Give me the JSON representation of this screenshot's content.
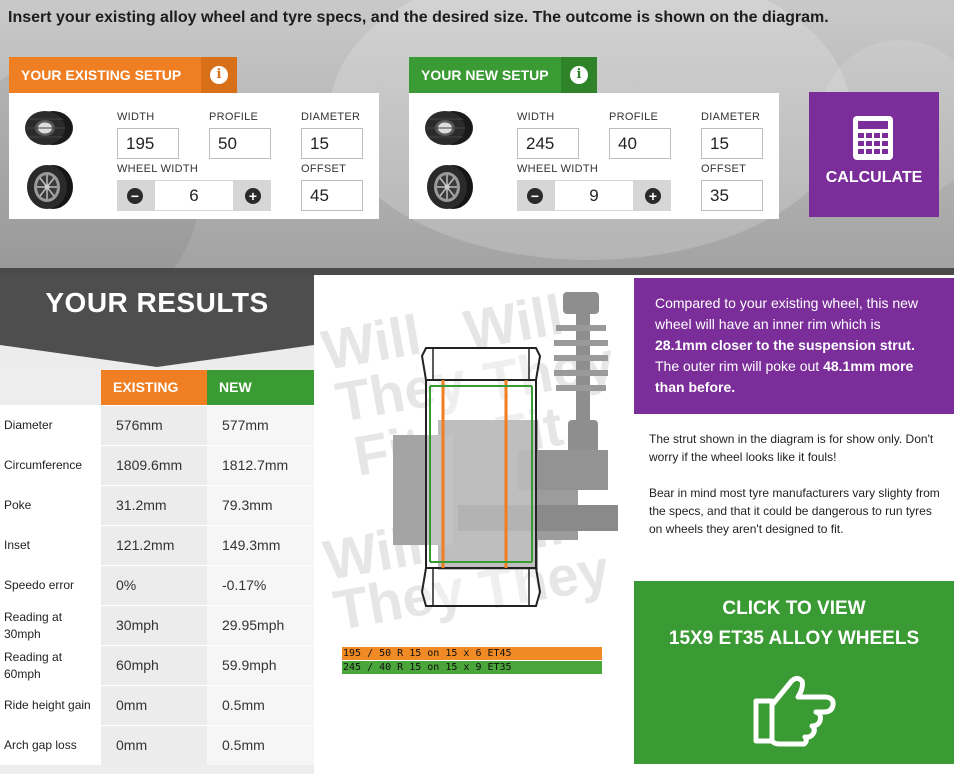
{
  "instructions": "Insert your existing alloy wheel and tyre specs, and the desired size. The outcome is shown on the diagram.",
  "existing_setup": {
    "title": "YOUR EXISTING SETUP",
    "width_label": "WIDTH",
    "width": "195",
    "profile_label": "PROFILE",
    "profile": "50",
    "diameter_label": "DIAMETER",
    "diameter": "15",
    "wheel_width_label": "WHEEL WIDTH",
    "wheel_width": "6",
    "offset_label": "OFFSET",
    "offset": "45"
  },
  "new_setup": {
    "title": "YOUR NEW SETUP",
    "width_label": "WIDTH",
    "width": "245",
    "profile_label": "PROFILE",
    "profile": "40",
    "diameter_label": "DIAMETER",
    "diameter": "15",
    "wheel_width_label": "WHEEL WIDTH",
    "wheel_width": "9",
    "offset_label": "OFFSET",
    "offset": "35"
  },
  "calculate_label": "CALCULATE",
  "results": {
    "title": "YOUR RESULTS",
    "col_existing": "EXISTING",
    "col_new": "NEW",
    "rows": [
      {
        "label": "Diameter",
        "existing": "576mm",
        "new": "577mm"
      },
      {
        "label": "Circumference",
        "existing": "1809.6mm",
        "new": "1812.7mm"
      },
      {
        "label": "Poke",
        "existing": "31.2mm",
        "new": "79.3mm"
      },
      {
        "label": "Inset",
        "existing": "121.2mm",
        "new": "149.3mm"
      },
      {
        "label": "Speedo error",
        "existing": "0%",
        "new": "-0.17%"
      },
      {
        "label": "Reading at 30mph",
        "existing": "30mph",
        "new": "29.95mph"
      },
      {
        "label": "Reading at 60mph",
        "existing": "60mph",
        "new": "59.9mph"
      },
      {
        "label": "Ride height gain",
        "existing": "0mm",
        "new": "0.5mm"
      },
      {
        "label": "Arch gap loss",
        "existing": "0mm",
        "new": "0.5mm"
      }
    ]
  },
  "diagram": {
    "watermark": [
      "Will",
      "They",
      "Fit",
      ".com"
    ],
    "legend_existing": "195 / 50 R 15 on 15 x 6 ET45",
    "legend_new": "245 / 40 R 15 on 15 x 9 ET35",
    "existing_color": "#ef7f22",
    "new_color": "#3a9a33"
  },
  "summary": {
    "part1": "Compared to your existing wheel, this new wheel will have an inner rim which is ",
    "bold1": "28.1mm closer to the suspension strut.",
    "part2": " The outer rim will poke out ",
    "bold2": "48.1mm more than before."
  },
  "notes": {
    "p1": "The strut shown in the diagram is for show only. Don't worry if the wheel looks like it fouls!",
    "p2": "Bear in mind most tyre manufacturers vary slighty from the specs, and that it could be dangerous to run tyres on wheels they aren't designed to fit."
  },
  "cta": {
    "line1": "CLICK TO VIEW",
    "line2": "15X9 ET35 ALLOY WHEELS",
    "icon": "pointing-hand-icon"
  },
  "colors": {
    "orange": "#ef7f22",
    "green": "#3a9a33",
    "purple": "#7b2d9a",
    "dark": "#4e4e4e"
  }
}
